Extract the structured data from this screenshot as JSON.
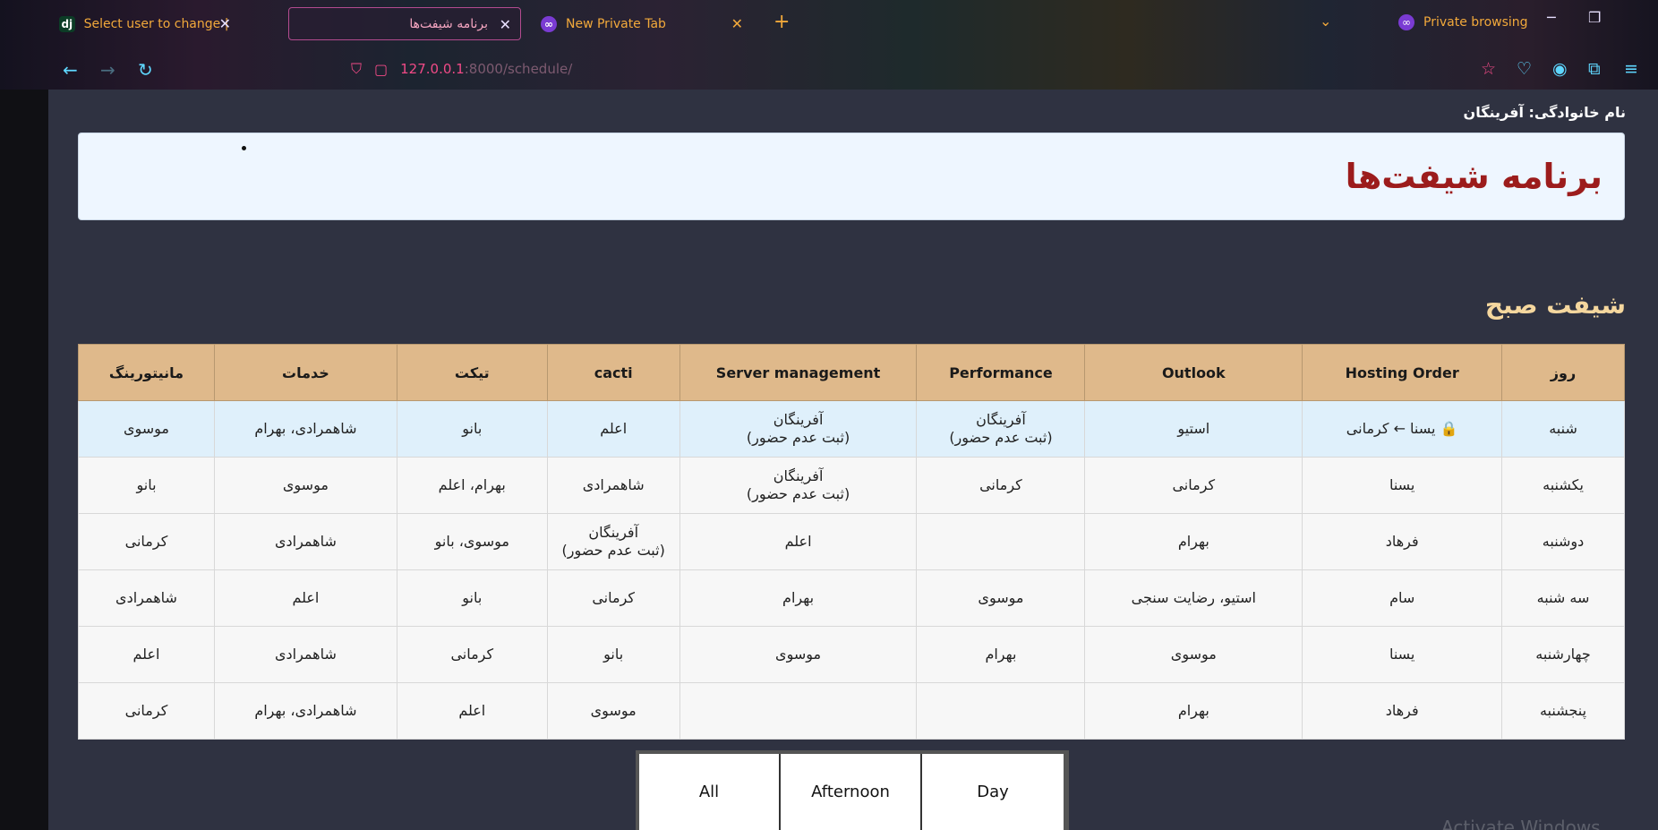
{
  "browser": {
    "tabs": [
      {
        "label": "Select user to change | طبقه ها",
        "icon": "django-icon",
        "active": false
      },
      {
        "label": "برنامه شیفت‌ها",
        "active": true
      },
      {
        "label": "New Private Tab",
        "icon": "private-mask-icon",
        "active": false
      }
    ],
    "new_tab_symbol": "+",
    "private_label": "Private browsing",
    "url_host": "127.0.0.1",
    "url_rest": ":8000/schedule/"
  },
  "page": {
    "family_label": "نام خانوادگی: آفرینگان",
    "title": "برنامه شیفت‌ها",
    "section_title": "شیفت صبح"
  },
  "table": {
    "headers": [
      "روز",
      "Hosting Order",
      "Outlook",
      "Performance",
      "Server management",
      "cacti",
      "تیکت",
      "خدمات",
      "مانیتورینگ"
    ],
    "rows": [
      {
        "day": "شنبه",
        "cells": [
          {
            "text": "🔒 یسنا ← کرمانی",
            "style": "locked"
          },
          {
            "text": "استیو"
          },
          {
            "text": "آفرینگان",
            "note": "(ثبت عدم حضور)",
            "style": "absent"
          },
          {
            "text": "آفرینگان",
            "note": "(ثبت عدم حضور)",
            "style": "absent"
          },
          {
            "text": "اعلم"
          },
          {
            "text": "بانو"
          },
          {
            "text": "شاهمرادی، بهرام"
          },
          {
            "text": "موسوی"
          }
        ]
      },
      {
        "day": "یکشنبه",
        "cells": [
          {
            "text": "یسنا"
          },
          {
            "text": "کرمانی"
          },
          {
            "text": "کرمانی"
          },
          {
            "text": "آفرینگان",
            "note": "(ثبت عدم حضور)",
            "style": "absent"
          },
          {
            "text": "شاهمرادی"
          },
          {
            "text": "بهرام، اعلم"
          },
          {
            "text": "موسوی"
          },
          {
            "text": "بانو"
          }
        ]
      },
      {
        "day": "دوشنبه",
        "cells": [
          {
            "text": "فرهاد"
          },
          {
            "text": "بهرام"
          },
          {
            "text": ""
          },
          {
            "text": "اعلم"
          },
          {
            "text": "آفرینگان",
            "note": "(ثبت عدم حضور)",
            "style": "absent"
          },
          {
            "text": "موسوی، بانو"
          },
          {
            "text": "شاهمرادی"
          },
          {
            "text": "کرمانی"
          }
        ]
      },
      {
        "day": "سه شنبه",
        "cells": [
          {
            "text": "سام"
          },
          {
            "text": "استیو، رضایت سنجی"
          },
          {
            "text": "موسوی"
          },
          {
            "text": "بهرام"
          },
          {
            "text": "کرمانی"
          },
          {
            "text": "بانو"
          },
          {
            "text": "اعلم"
          },
          {
            "text": "شاهمرادی"
          }
        ]
      },
      {
        "day": "چهارشنبه",
        "cells": [
          {
            "text": "یسنا"
          },
          {
            "text": "موسوی"
          },
          {
            "text": "بهرام"
          },
          {
            "text": "موسوی"
          },
          {
            "text": "بانو"
          },
          {
            "text": "کرمانی"
          },
          {
            "text": "شاهمرادی"
          },
          {
            "text": "اعلم"
          }
        ]
      },
      {
        "day": "پنجشنبه",
        "cells": [
          {
            "text": "فرهاد"
          },
          {
            "text": "بهرام"
          },
          {
            "text": ""
          },
          {
            "text": ""
          },
          {
            "text": "موسوی"
          },
          {
            "text": "اعلم"
          },
          {
            "text": "شاهمرادی، بهرام"
          },
          {
            "text": "کرمانی"
          }
        ]
      }
    ]
  },
  "filters": {
    "all_label": "All",
    "afternoon_label": "Afternoon",
    "day_label": "Day"
  },
  "watermark": "Activate Windows",
  "colors": {
    "header_bg": "#dfb98b",
    "title_red": "#9c1c1c",
    "section_title": "#f5d79e",
    "page_bg": "#2f3241",
    "highlight_row": "#dff0fb"
  }
}
